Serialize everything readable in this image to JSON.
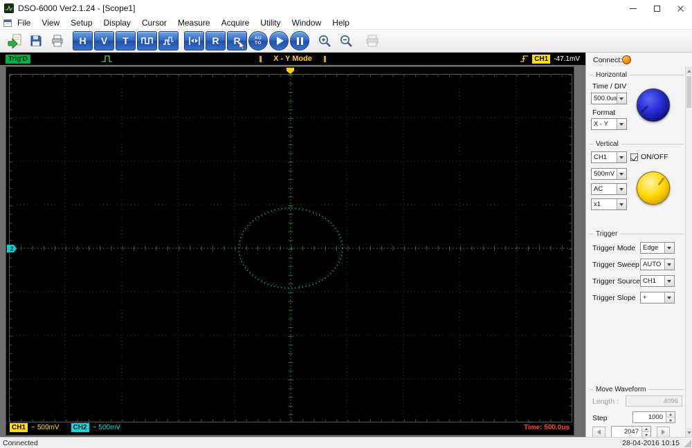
{
  "colors": {
    "ch1": "#ffe000",
    "ch2": "#00e0e0",
    "time_readout": "#ff4632",
    "trig_badge_bg": "#00b050",
    "connect_indicator": "#ff8a00",
    "horizontal_knob": "#2230d0",
    "vertical_knob": "#ffd800",
    "toolbar_button": "#2f66c4",
    "grid": "#1e4f1e"
  },
  "window": {
    "title": "DSO-6000 Ver2.1.24 - [Scope1]"
  },
  "menu": {
    "items": [
      "File",
      "View",
      "Setup",
      "Display",
      "Cursor",
      "Measure",
      "Acquire",
      "Utility",
      "Window",
      "Help"
    ]
  },
  "toolbar": {
    "h_label": "H",
    "v_label": "V",
    "t_label": "T",
    "r_label": "R",
    "r2_label": "R",
    "auto_line1": "AU",
    "auto_line2": "TO"
  },
  "trig_strip": {
    "status": "Trig'D",
    "mode": "X - Y Mode",
    "channel": "CH1",
    "level": "-47.1mV"
  },
  "scope": {
    "ch2_marker": "2",
    "ch1_label": "CH1",
    "ch1_coupling": "~",
    "ch1_scale": "500mV",
    "ch2_label": "CH2",
    "ch2_coupling": "~",
    "ch2_scale": "500mV",
    "time_readout": "Time: 500.0us",
    "trace": {
      "type": "xy-ellipse",
      "center_div": [
        0,
        0
      ],
      "rx_div": 0.92,
      "ry_div": 0.92,
      "grid_divisions": [
        10,
        8
      ]
    }
  },
  "panel": {
    "connect_label": "Connect:",
    "horizontal": {
      "title": "Horizontal",
      "time_div_label": "Time / DIV",
      "time_div_value": "500.0us",
      "format_label": "Format",
      "format_value": "X - Y"
    },
    "vertical": {
      "title": "Vertical",
      "channel_value": "CH1",
      "onoff_label": "ON/OFF",
      "onoff_checked": true,
      "scale_value": "500mV",
      "coupling_value": "AC",
      "probe_value": "x1"
    },
    "trigger": {
      "title": "Trigger",
      "mode_label": "Trigger Mode",
      "mode_value": "Edge",
      "sweep_label": "Trigger Sweep",
      "sweep_value": "AUTO",
      "source_label": "Trigger Source",
      "source_value": "CH1",
      "slope_label": "Trigger Slope",
      "slope_value": "+"
    },
    "move_waveform": {
      "title": "Move Waveform",
      "length_label": "Length :",
      "length_value": "4096",
      "step_label": "Step",
      "step_value": "1000",
      "position_value": "2047"
    }
  },
  "statusbar": {
    "left": "Connected",
    "right": "28-04-2016 10:15"
  }
}
